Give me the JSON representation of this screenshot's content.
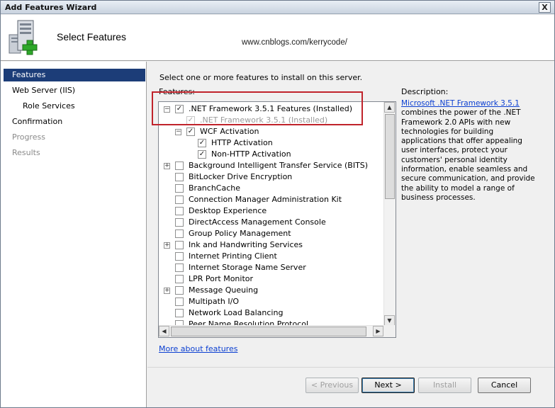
{
  "window": {
    "title": "Add Features Wizard",
    "close_glyph": "X"
  },
  "header": {
    "page_title": "Select Features",
    "watermark": "www.cnblogs.com/kerrycode/"
  },
  "nav": {
    "items": [
      {
        "label": "Features",
        "state": "selected"
      },
      {
        "label": "Web Server (IIS)",
        "state": "normal"
      },
      {
        "label": "Role Services",
        "state": "normal"
      },
      {
        "label": "Confirmation",
        "state": "normal"
      },
      {
        "label": "Progress",
        "state": "disabled"
      },
      {
        "label": "Results",
        "state": "disabled"
      }
    ]
  },
  "main": {
    "instruction": "Select one or more features to install on this server.",
    "features_label": "Features:",
    "description_label": "Description:",
    "description_link": "Microsoft .NET Framework 3.5.1",
    "description_text": "combines the power of the .NET Framework 2.0 APIs with new technologies for building applications that offer appealing user interfaces, protect your customers' personal identity information, enable seamless and secure communication, and provide the ability to model a range of business processes.",
    "more_link": "More about features"
  },
  "features": [
    {
      "label": ".NET Framework 3.5.1 Features  (Installed)",
      "level": 0,
      "expander": "minus",
      "checked": true,
      "disabled": false
    },
    {
      "label": ".NET Framework 3.5.1  (Installed)",
      "level": 1,
      "expander": "none",
      "checked": true,
      "disabled": true
    },
    {
      "label": "WCF Activation",
      "level": 1,
      "expander": "minus",
      "checked": true,
      "disabled": false
    },
    {
      "label": "HTTP Activation",
      "level": 2,
      "expander": "none",
      "checked": true,
      "disabled": false
    },
    {
      "label": "Non-HTTP Activation",
      "level": 2,
      "expander": "none",
      "checked": true,
      "disabled": false
    },
    {
      "label": "Background Intelligent Transfer Service (BITS)",
      "level": 0,
      "expander": "plus",
      "checked": false,
      "disabled": false
    },
    {
      "label": "BitLocker Drive Encryption",
      "level": 0,
      "expander": "none",
      "checked": false,
      "disabled": false
    },
    {
      "label": "BranchCache",
      "level": 0,
      "expander": "none",
      "checked": false,
      "disabled": false
    },
    {
      "label": "Connection Manager Administration Kit",
      "level": 0,
      "expander": "none",
      "checked": false,
      "disabled": false
    },
    {
      "label": "Desktop Experience",
      "level": 0,
      "expander": "none",
      "checked": false,
      "disabled": false
    },
    {
      "label": "DirectAccess Management Console",
      "level": 0,
      "expander": "none",
      "checked": false,
      "disabled": false
    },
    {
      "label": "Group Policy Management",
      "level": 0,
      "expander": "none",
      "checked": false,
      "disabled": false
    },
    {
      "label": "Ink and Handwriting Services",
      "level": 0,
      "expander": "plus",
      "checked": false,
      "disabled": false
    },
    {
      "label": "Internet Printing Client",
      "level": 0,
      "expander": "none",
      "checked": false,
      "disabled": false
    },
    {
      "label": "Internet Storage Name Server",
      "level": 0,
      "expander": "none",
      "checked": false,
      "disabled": false
    },
    {
      "label": "LPR Port Monitor",
      "level": 0,
      "expander": "none",
      "checked": false,
      "disabled": false
    },
    {
      "label": "Message Queuing",
      "level": 0,
      "expander": "plus",
      "checked": false,
      "disabled": false
    },
    {
      "label": "Multipath I/O",
      "level": 0,
      "expander": "none",
      "checked": false,
      "disabled": false
    },
    {
      "label": "Network Load Balancing",
      "level": 0,
      "expander": "none",
      "checked": false,
      "disabled": false
    },
    {
      "label": "Peer Name Resolution Protocol",
      "level": 0,
      "expander": "none",
      "checked": false,
      "disabled": false
    }
  ],
  "buttons": {
    "previous": "< Previous",
    "next": "Next >",
    "install": "Install",
    "cancel": "Cancel"
  },
  "colors": {
    "nav_selected": "#1c3d78",
    "highlight_box": "#c0232b",
    "link": "#0b3fd1"
  }
}
